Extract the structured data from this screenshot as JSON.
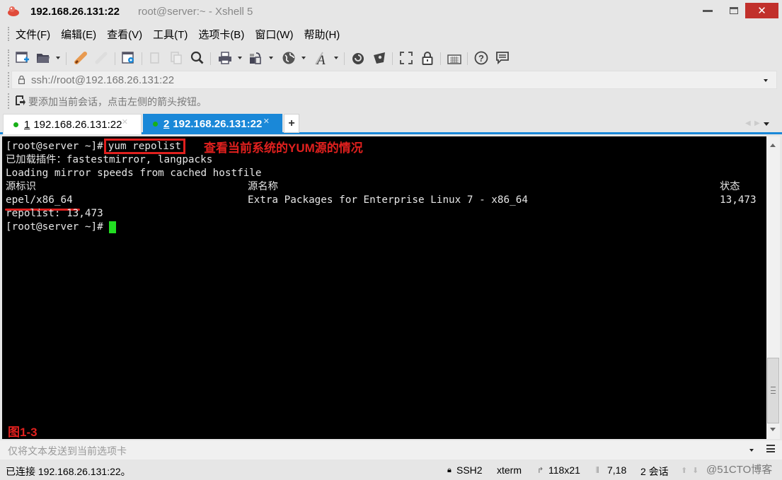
{
  "window": {
    "title_host": "192.168.26.131:22",
    "title_sub": "root@server:~ - Xshell 5",
    "close_glyph": "✕"
  },
  "menu": {
    "items": [
      "文件(F)",
      "编辑(E)",
      "查看(V)",
      "工具(T)",
      "选项卡(B)",
      "窗口(W)",
      "帮助(H)"
    ]
  },
  "toolbar": {
    "icons": [
      "new-session-icon",
      "open-folder-icon",
      "connect-icon",
      "disconnect-icon",
      "session-properties-icon",
      "copy-icon",
      "paste-icon",
      "find-icon",
      "print-icon",
      "transfer-icon",
      "globe-icon",
      "font-icon",
      "xftp-icon",
      "xmanager-icon",
      "fullscreen-icon",
      "lock-icon",
      "keyboard-icon",
      "help-icon",
      "chat-icon"
    ]
  },
  "address": {
    "value": "ssh://root@192.168.26.131:22"
  },
  "hint": {
    "text": "要添加当前会话，点击左侧的箭头按钮。"
  },
  "tabs": [
    {
      "num": "1",
      "label": "192.168.26.131:22",
      "active": false,
      "status_color": "#18b018"
    },
    {
      "num": "2",
      "label": "192.168.26.131:22",
      "active": true,
      "status_color": "#18b018"
    }
  ],
  "tab_add_label": "+",
  "terminal": {
    "prompt": "[root@server ~]#",
    "command": "yum repolist",
    "annotation": "查看当前系统的YUM源的情况",
    "lines": [
      "已加载插件：fastestmirror, langpacks",
      "Loading mirror speeds from cached hostfile"
    ],
    "table_headers": {
      "id": "源标识",
      "name": "源名称",
      "status": "状态"
    },
    "table_rows": [
      {
        "id": "epel/x86_64",
        "name": "Extra Packages for Enterprise Linux 7 - x86_64",
        "status": "13,473"
      }
    ],
    "summary": "repolist: 13,473",
    "figure_label": "图1-3"
  },
  "sendbar": {
    "placeholder": "仅将文本发送到当前选项卡"
  },
  "status": {
    "connected": "已连接 192.168.26.131:22。",
    "protocol": "SSH2",
    "term_type": "xterm",
    "size": "118x21",
    "cursor_pos": "7,18",
    "sessions": "2 会话",
    "watermark": "@51CTO博客"
  },
  "colors": {
    "accent": "#1a88d8",
    "close": "#c1302b",
    "annotation": "#e0201e",
    "cursor": "#22dd22"
  }
}
